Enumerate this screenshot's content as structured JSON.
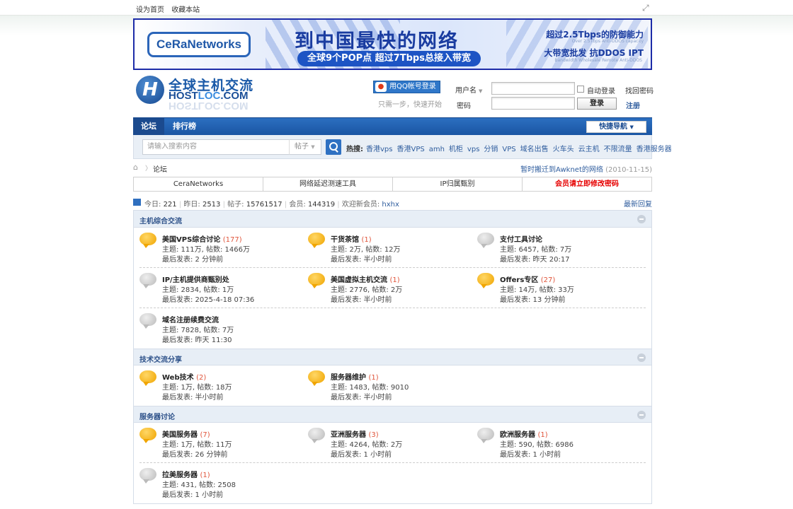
{
  "top": {
    "set_home": "设为首页",
    "bookmark": "收藏本站"
  },
  "banner": {
    "brand": "CeRaNetworks",
    "headline": "到中国最快的网络",
    "sub": "全球9个POP点  超过7Tbps总接入带宽",
    "r1": "超过2.5Tbps的防御能力",
    "r1_small": "Over 2.5Tbps Anti-DDOS capacity",
    "r2": "大带宽批发  抗DDOS IPT",
    "r2_small": "Bandwidth Wholesale  Remote Anti-DDOS"
  },
  "logo": {
    "cn": "全球主机交流",
    "en_a": "HOST",
    "en_b": "LOC",
    "en_c": ".COM"
  },
  "login": {
    "qq_btn": "用QQ帐号登录",
    "qq_tip": "只需一步，快速开始",
    "username_label": "用户名",
    "password_label": "密码",
    "auto_login": "自动登录",
    "forgot": "找回密码",
    "login_btn": "登录",
    "register": "注册"
  },
  "nav": {
    "forum": "论坛",
    "ranking": "排行榜",
    "quick_nav": "快捷导航"
  },
  "search": {
    "placeholder": "请输入搜索内容",
    "type": "帖子",
    "hot_label": "热搜:",
    "hot": [
      "香港vps",
      "香港VPS",
      "amh",
      "机柜",
      "vps",
      "分销",
      "VPS",
      "域名出售",
      "火车头",
      "云主机",
      "不限流量",
      "香港服务器"
    ]
  },
  "crumb": {
    "current": "论坛",
    "notice": "暂时搬迁到Awknet的网络",
    "notice_date": "(2010-11-15)"
  },
  "tabs": [
    "CeraNetworks",
    "网络延迟测速工具",
    "IP归属甄别",
    "会员请立即修改密码"
  ],
  "stats": {
    "today_label": "今日:",
    "today": "221",
    "yesterday_label": "昨日:",
    "yesterday": "2513",
    "posts_label": "帖子:",
    "posts": "15761517",
    "members_label": "会员:",
    "members": "144319",
    "newest_label": "欢迎新会员:",
    "newest": "hxhx",
    "latest": "最新回复"
  },
  "sections": [
    {
      "title": "主机综合交流",
      "forums": [
        {
          "name": "美国VPS综合讨论",
          "new": "(177)",
          "stats": "主题: 111万, 帖数: 1466万",
          "last": "最后发表: 2 分钟前",
          "active": true
        },
        {
          "name": "干货茶馆",
          "new": "(1)",
          "stats": "主题: 2万, 帖数: 12万",
          "last": "最后发表: 半小时前",
          "active": true
        },
        {
          "name": "支付工具讨论",
          "new": "",
          "stats": "主题: 6457, 帖数: 7万",
          "last": "最后发表: 昨天 20:17",
          "active": false
        },
        {
          "name": "IP/主机提供商甄别处",
          "new": "",
          "stats": "主题: 2834, 帖数: 1万",
          "last": "最后发表: 2025-4-18 07:36",
          "active": false
        },
        {
          "name": "美国虚拟主机交流",
          "new": "(1)",
          "stats": "主题: 2776, 帖数: 2万",
          "last": "最后发表: 半小时前",
          "active": true
        },
        {
          "name": "Offers专区",
          "new": "(27)",
          "stats": "主题: 14万, 帖数: 33万",
          "last": "最后发表: 13 分钟前",
          "active": true
        },
        {
          "name": "域名注册续费交流",
          "new": "",
          "stats": "主题: 7828, 帖数: 7万",
          "last": "最后发表: 昨天 11:30",
          "active": false
        }
      ]
    },
    {
      "title": "技术交流分享",
      "forums": [
        {
          "name": "Web技术",
          "new": "(2)",
          "stats": "主题: 1万, 帖数: 18万",
          "last": "最后发表: 半小时前",
          "active": true
        },
        {
          "name": "服务器维护",
          "new": "(1)",
          "stats": "主题: 1483, 帖数: 9010",
          "last": "最后发表: 半小时前",
          "active": true
        }
      ]
    },
    {
      "title": "服务器讨论",
      "forums": [
        {
          "name": "美国服务器",
          "new": "(7)",
          "stats": "主题: 1万, 帖数: 11万",
          "last": "最后发表: 26 分钟前",
          "active": true
        },
        {
          "name": "亚洲服务器",
          "new": "(3)",
          "stats": "主题: 4264, 帖数: 2万",
          "last": "最后发表: 1 小时前",
          "active": false
        },
        {
          "name": "欧洲服务器",
          "new": "(1)",
          "stats": "主题: 590, 帖数: 6986",
          "last": "最后发表: 1 小时前",
          "active": false
        },
        {
          "name": "拉美服务器",
          "new": "(1)",
          "stats": "主题: 431, 帖数: 2508",
          "last": "最后发表: 1 小时前",
          "active": false
        }
      ]
    }
  ],
  "colors": {
    "nav": "#1a55a3",
    "accent": "#2f5d9e",
    "alert": "#e60000",
    "bubble_active": "#f0a500",
    "bubble_idle": "#bbbbbb"
  }
}
